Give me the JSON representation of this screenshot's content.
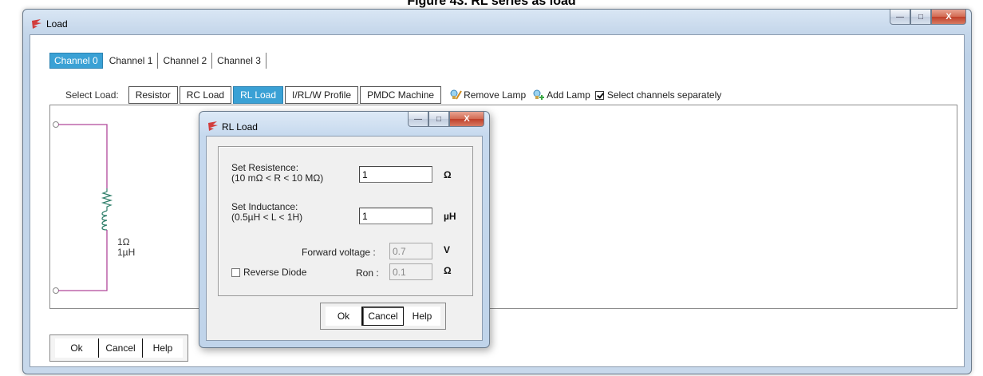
{
  "document_caption": "Figure 43. RL series as load",
  "main_window": {
    "title": "Load",
    "caption_buttons": {
      "minimize": "—",
      "maximize": "□",
      "close": "X"
    }
  },
  "channel_tabs": [
    "Channel 0",
    "Channel 1",
    "Channel 2",
    "Channel 3"
  ],
  "active_channel": "Channel 0",
  "load_select": {
    "label": "Select Load:",
    "types": [
      "Resistor",
      "RC Load",
      "RL Load",
      "I/RL/W Profile",
      "PMDC Machine"
    ],
    "active": "RL Load",
    "remove_lamp": "Remove Lamp",
    "add_lamp": "Add Lamp",
    "select_channels_separately": "Select channels separately",
    "select_channels_checked": true
  },
  "circuit": {
    "resistance_text": "1Ω",
    "inductance_text": "1µH",
    "wire_color": "#b0479a"
  },
  "main_buttons": {
    "ok": "Ok",
    "cancel": "Cancel",
    "help": "Help"
  },
  "dialog": {
    "title": "RL Load",
    "resistance": {
      "label": "Set Resistence:",
      "range": "(10 mΩ < R < 10 MΩ)",
      "value": "1",
      "unit": "Ω"
    },
    "inductance": {
      "label": "Set Inductance:",
      "range": "(0.5µH < L < 1H)",
      "value": "1",
      "unit": "µH"
    },
    "forward_voltage": {
      "label": "Forward voltage :",
      "value": "0.7",
      "unit": "V"
    },
    "reverse_diode": {
      "label": "Reverse Diode",
      "checked": false
    },
    "ron": {
      "label": "Ron :",
      "value": "0.1",
      "unit": "Ω"
    },
    "buttons": {
      "ok": "Ok",
      "cancel": "Cancel",
      "help": "Help"
    }
  },
  "colors": {
    "accent_tab": "#3aa1d5",
    "close_button": "#c0402a",
    "icon_red": "#d23c3c"
  }
}
